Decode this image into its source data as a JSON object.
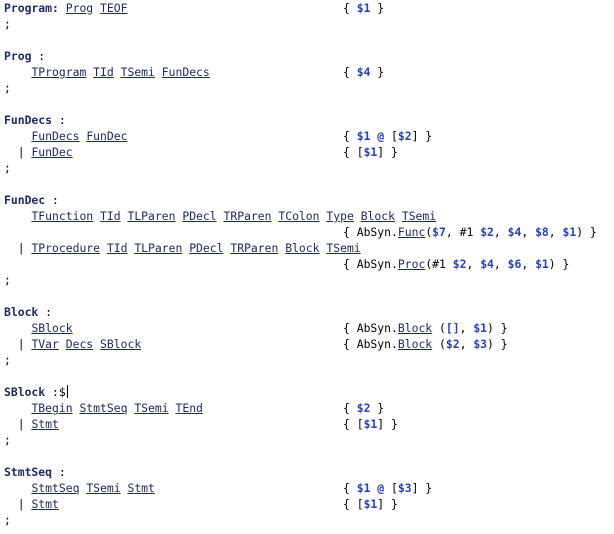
{
  "editor": {
    "lines": [
      {
        "t": 0,
        "lhs": [
          [
            "nt",
            "Program:"
          ],
          [
            "p",
            " "
          ],
          [
            "tok",
            "Prog"
          ],
          [
            "p",
            " "
          ],
          [
            "tok",
            "TEOF"
          ]
        ],
        "act": [
          [
            "p",
            "{ "
          ],
          [
            "dv",
            "$1"
          ],
          [
            "p",
            " }"
          ]
        ]
      },
      {
        "t": 16,
        "lhs": [
          [
            "p",
            ";"
          ]
        ]
      },
      {
        "t": 48,
        "lhs": [
          [
            "nt",
            "Prog"
          ],
          [
            "p",
            " :"
          ]
        ]
      },
      {
        "t": 64,
        "lhs": [
          [
            "p",
            "    "
          ],
          [
            "tok",
            "TProgram"
          ],
          [
            "p",
            " "
          ],
          [
            "tok",
            "TId"
          ],
          [
            "p",
            " "
          ],
          [
            "tok",
            "TSemi"
          ],
          [
            "p",
            " "
          ],
          [
            "tok",
            "FunDecs"
          ]
        ],
        "act": [
          [
            "p",
            "{ "
          ],
          [
            "dv",
            "$4"
          ],
          [
            "p",
            " }"
          ]
        ]
      },
      {
        "t": 80,
        "lhs": [
          [
            "p",
            ";"
          ]
        ]
      },
      {
        "t": 112,
        "lhs": [
          [
            "nt",
            "FunDecs"
          ],
          [
            "p",
            " :"
          ]
        ]
      },
      {
        "t": 128,
        "lhs": [
          [
            "p",
            "    "
          ],
          [
            "tok",
            "FunDecs"
          ],
          [
            "p",
            " "
          ],
          [
            "tok",
            "FunDec"
          ]
        ],
        "act": [
          [
            "p",
            "{ "
          ],
          [
            "dv",
            "$1"
          ],
          [
            "p",
            " "
          ],
          [
            "op",
            "@"
          ],
          [
            "p",
            " ["
          ],
          [
            "dv",
            "$2"
          ],
          [
            "p",
            "] }"
          ]
        ]
      },
      {
        "t": 144,
        "lhs": [
          [
            "p",
            "  | "
          ],
          [
            "tok",
            "FunDec"
          ]
        ],
        "act": [
          [
            "p",
            "{ ["
          ],
          [
            "dv",
            "$1"
          ],
          [
            "p",
            "] }"
          ]
        ]
      },
      {
        "t": 160,
        "lhs": [
          [
            "p",
            ";"
          ]
        ]
      },
      {
        "t": 192,
        "lhs": [
          [
            "nt",
            "FunDec"
          ],
          [
            "p",
            " :"
          ]
        ]
      },
      {
        "t": 208,
        "lhs": [
          [
            "p",
            "    "
          ],
          [
            "tok",
            "TFunction"
          ],
          [
            "p",
            " "
          ],
          [
            "tok",
            "TId"
          ],
          [
            "p",
            " "
          ],
          [
            "tok",
            "TLParen"
          ],
          [
            "p",
            " "
          ],
          [
            "tok",
            "PDecl"
          ],
          [
            "p",
            " "
          ],
          [
            "tok",
            "TRParen"
          ],
          [
            "p",
            " "
          ],
          [
            "tok",
            "TColon"
          ],
          [
            "p",
            " "
          ],
          [
            "tok",
            "Type"
          ],
          [
            "p",
            " "
          ],
          [
            "tok",
            "Block"
          ],
          [
            "p",
            " "
          ],
          [
            "tok",
            "TSemi"
          ]
        ]
      },
      {
        "t": 224,
        "act": [
          [
            "p",
            "{ AbSyn."
          ],
          [
            "ref",
            "Func"
          ],
          [
            "p",
            "("
          ],
          [
            "dv",
            "$7"
          ],
          [
            "p",
            ", #1 "
          ],
          [
            "dv",
            "$2"
          ],
          [
            "p",
            ", "
          ],
          [
            "dv",
            "$4"
          ],
          [
            "p",
            ", "
          ],
          [
            "dv",
            "$8"
          ],
          [
            "p",
            ", "
          ],
          [
            "dv",
            "$1"
          ],
          [
            "p",
            ") }"
          ]
        ]
      },
      {
        "t": 240,
        "lhs": [
          [
            "p",
            "  | "
          ],
          [
            "tok",
            "TProcedure"
          ],
          [
            "p",
            " "
          ],
          [
            "tok",
            "TId"
          ],
          [
            "p",
            " "
          ],
          [
            "tok",
            "TLParen"
          ],
          [
            "p",
            " "
          ],
          [
            "tok",
            "PDecl"
          ],
          [
            "p",
            " "
          ],
          [
            "tok",
            "TRParen"
          ],
          [
            "p",
            " "
          ],
          [
            "tok",
            "Block"
          ],
          [
            "p",
            " "
          ],
          [
            "tok",
            "TSemi"
          ]
        ]
      },
      {
        "t": 256,
        "act": [
          [
            "p",
            "{ AbSyn."
          ],
          [
            "ref",
            "Proc"
          ],
          [
            "p",
            "(#1 "
          ],
          [
            "dv",
            "$2"
          ],
          [
            "p",
            ", "
          ],
          [
            "dv",
            "$4"
          ],
          [
            "p",
            ", "
          ],
          [
            "dv",
            "$6"
          ],
          [
            "p",
            ", "
          ],
          [
            "dv",
            "$1"
          ],
          [
            "p",
            ") }"
          ]
        ]
      },
      {
        "t": 272,
        "lhs": [
          [
            "p",
            ";"
          ]
        ]
      },
      {
        "t": 304,
        "lhs": [
          [
            "nt",
            "Block"
          ],
          [
            "p",
            " :"
          ]
        ]
      },
      {
        "t": 320,
        "lhs": [
          [
            "p",
            "    "
          ],
          [
            "tok",
            "SBlock"
          ]
        ],
        "act": [
          [
            "p",
            "{ AbSyn."
          ],
          [
            "ref",
            "Block"
          ],
          [
            "p",
            " ("
          ],
          [
            "op",
            "[]"
          ],
          [
            "p",
            ", "
          ],
          [
            "dv",
            "$1"
          ],
          [
            "p",
            ") }"
          ]
        ]
      },
      {
        "t": 336,
        "lhs": [
          [
            "p",
            "  | "
          ],
          [
            "tok",
            "TVar"
          ],
          [
            "p",
            " "
          ],
          [
            "tok",
            "Decs"
          ],
          [
            "p",
            " "
          ],
          [
            "tok",
            "SBlock"
          ]
        ],
        "act": [
          [
            "p",
            "{ AbSyn."
          ],
          [
            "ref",
            "Block"
          ],
          [
            "p",
            " ("
          ],
          [
            "dv",
            "$2"
          ],
          [
            "p",
            ", "
          ],
          [
            "dv",
            "$3"
          ],
          [
            "p",
            ") }"
          ]
        ]
      },
      {
        "t": 352,
        "lhs": [
          [
            "p",
            ";"
          ]
        ]
      },
      {
        "t": 384,
        "lhs": [
          [
            "nt",
            "SBlock"
          ],
          [
            "p",
            " :$"
          ]
        ],
        "cursor": true
      },
      {
        "t": 400,
        "lhs": [
          [
            "p",
            "    "
          ],
          [
            "tok",
            "TBegin"
          ],
          [
            "p",
            " "
          ],
          [
            "tok",
            "StmtSeq"
          ],
          [
            "p",
            " "
          ],
          [
            "tok",
            "TSemi"
          ],
          [
            "p",
            " "
          ],
          [
            "tok",
            "TEnd"
          ]
        ],
        "act": [
          [
            "p",
            "{ "
          ],
          [
            "dv",
            "$2"
          ],
          [
            "p",
            " }"
          ]
        ]
      },
      {
        "t": 416,
        "lhs": [
          [
            "p",
            "  | "
          ],
          [
            "tok",
            "Stmt"
          ]
        ],
        "act": [
          [
            "p",
            "{ ["
          ],
          [
            "dv",
            "$1"
          ],
          [
            "p",
            "] }"
          ]
        ]
      },
      {
        "t": 432,
        "lhs": [
          [
            "p",
            ";"
          ]
        ]
      },
      {
        "t": 464,
        "lhs": [
          [
            "nt",
            "StmtSeq"
          ],
          [
            "p",
            " :"
          ]
        ]
      },
      {
        "t": 480,
        "lhs": [
          [
            "p",
            "    "
          ],
          [
            "tok",
            "StmtSeq"
          ],
          [
            "p",
            " "
          ],
          [
            "tok",
            "TSemi"
          ],
          [
            "p",
            " "
          ],
          [
            "tok",
            "Stmt"
          ]
        ],
        "act": [
          [
            "p",
            "{ "
          ],
          [
            "dv",
            "$1"
          ],
          [
            "p",
            " "
          ],
          [
            "op",
            "@"
          ],
          [
            "p",
            " ["
          ],
          [
            "dv",
            "$3"
          ],
          [
            "p",
            "] }"
          ]
        ]
      },
      {
        "t": 496,
        "lhs": [
          [
            "p",
            "  | "
          ],
          [
            "tok",
            "Stmt"
          ]
        ],
        "act": [
          [
            "p",
            "{ ["
          ],
          [
            "dv",
            "$1"
          ],
          [
            "p",
            "] }"
          ]
        ]
      },
      {
        "t": 512,
        "lhs": [
          [
            "p",
            ";"
          ]
        ]
      }
    ]
  },
  "colors": {
    "nonterminal": "#1a2a6c",
    "token": "#1a2a6c",
    "dollar_var": "#1f3fcc",
    "background": "#ffffff"
  }
}
